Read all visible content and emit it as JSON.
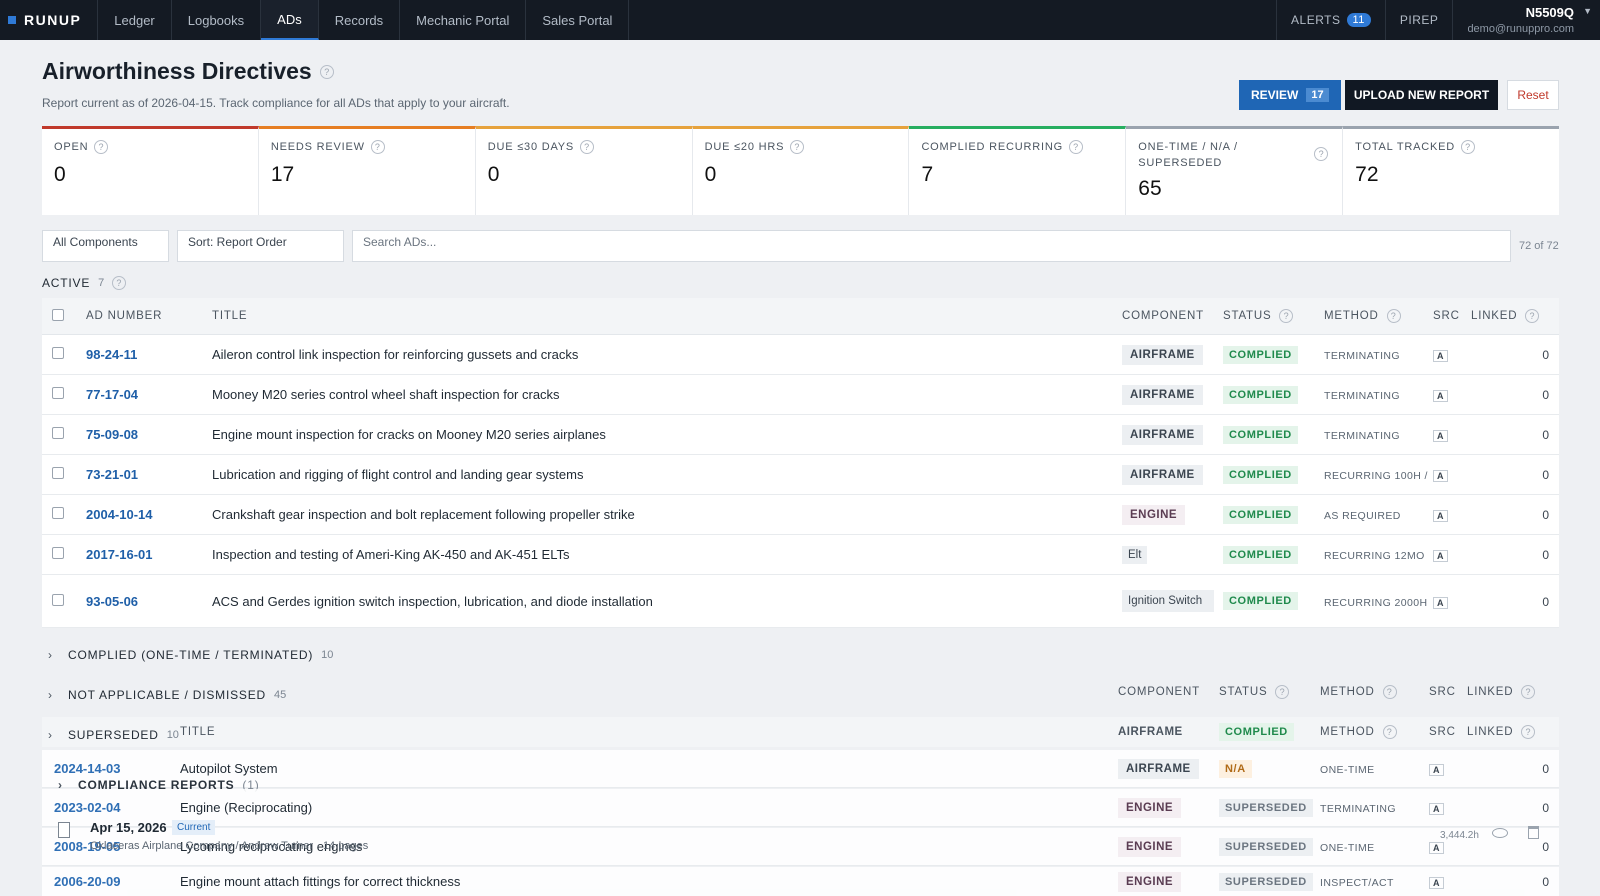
{
  "nav": {
    "brand": "RUNUP",
    "items": [
      "Ledger",
      "Logbooks",
      "ADs",
      "Records",
      "Mechanic Portal",
      "Sales Portal"
    ],
    "alerts_label": "ALERTS",
    "alerts_count": "11",
    "pirep": "PIREP",
    "tail": "N5509Q",
    "email": "demo@runuppro.com"
  },
  "header": {
    "title": "Airworthiness Directives",
    "help": "?",
    "subtitle": "Report current as of 2026-04-15. Track compliance for all ADs that apply to your aircraft.",
    "review_label": "REVIEW",
    "review_count": "17",
    "upload_label": "UPLOAD NEW REPORT",
    "reset_label": "Reset"
  },
  "stats": [
    {
      "label": "OPEN",
      "value": "0",
      "color": "#c0392b"
    },
    {
      "label": "NEEDS REVIEW",
      "value": "17",
      "color": "#e67e22"
    },
    {
      "label": "DUE ≤30 DAYS",
      "value": "0",
      "color": "#e6a23c"
    },
    {
      "label": "DUE ≤20 HRS",
      "value": "0",
      "color": "#e6a23c"
    },
    {
      "label": "COMPLIED RECURRING",
      "value": "7",
      "color": "#27ae60"
    },
    {
      "label": "ONE-TIME / N/A / SUPERSEDED",
      "value": "65",
      "color": "#9aa3ae"
    },
    {
      "label": "TOTAL TRACKED",
      "value": "72",
      "color": "#9aa3ae"
    }
  ],
  "filters": {
    "component": "All Components",
    "sort": "Sort: Report Order",
    "search_placeholder": "Search ADs...",
    "count": "72 of 72"
  },
  "active": {
    "label": "ACTIVE",
    "count": "7"
  },
  "columns": {
    "ad": "AD NUMBER",
    "title": "TITLE",
    "component": "COMPONENT",
    "status": "STATUS",
    "method": "METHOD",
    "src": "SRC",
    "linked": "LINKED"
  },
  "rows": [
    {
      "ad": "98-24-11",
      "title": "Aileron control link inspection for reinforcing gussets and cracks",
      "component": "AIRFRAME",
      "status": "COMPLIED",
      "method": "TERMINATING",
      "src": "A",
      "linked": "0"
    },
    {
      "ad": "77-17-04",
      "title": "Mooney M20 series control wheel shaft inspection for cracks",
      "component": "AIRFRAME",
      "status": "COMPLIED",
      "method": "TERMINATING",
      "src": "A",
      "linked": "0"
    },
    {
      "ad": "75-09-08",
      "title": "Engine mount inspection for cracks on Mooney M20 series airplanes",
      "component": "AIRFRAME",
      "status": "COMPLIED",
      "method": "TERMINATING",
      "src": "A",
      "linked": "0"
    },
    {
      "ad": "73-21-01",
      "title": "Lubrication and rigging of flight control and landing gear systems",
      "component": "AIRFRAME",
      "status": "COMPLIED",
      "method": "RECURRING 100H /",
      "src": "A",
      "linked": "0"
    },
    {
      "ad": "2004-10-14",
      "title": "Crankshaft gear inspection and bolt replacement following propeller strike",
      "component": "ENGINE",
      "status": "COMPLIED",
      "method": "AS REQUIRED",
      "src": "A",
      "linked": "0"
    },
    {
      "ad": "2017-16-01",
      "title": "Inspection and testing of Ameri-King AK-450 and AK-451 ELTs",
      "component": "Elt",
      "status": "COMPLIED",
      "method": "RECURRING 12MO",
      "src": "A",
      "linked": "0"
    },
    {
      "ad": "93-05-06",
      "title": "ACS and Gerdes ignition switch inspection, lubrication, and diode installation",
      "component": "Ignition Switch",
      "status": "COMPLIED",
      "method": "RECURRING 2000H",
      "src": "A",
      "linked": "0"
    }
  ],
  "collapsed": [
    {
      "label": "COMPLIED (ONE-TIME / TERMINATED)",
      "count": "10"
    },
    {
      "label": "NOT APPLICABLE / DISMISSED",
      "count": "45"
    },
    {
      "label": "SUPERSEDED",
      "count": "10"
    }
  ],
  "overlap_rows": [
    {
      "ad": "2024-14-03",
      "title": "Autopilot System",
      "component": "AIRFRAME",
      "status": "N/A",
      "method": "ONE-TIME",
      "src": "A",
      "linked": "0"
    },
    {
      "ad": "2023-02-04",
      "title": "Engine (Reciprocating)",
      "component": "ENGINE",
      "status": "SUPERSEDED",
      "method": "TERMINATING",
      "src": "A",
      "linked": "0"
    },
    {
      "ad": "2008-19-05",
      "title": "Lycoming reciprocating engines",
      "component": "ENGINE",
      "status": "SUPERSEDED",
      "method": "ONE-TIME",
      "src": "A",
      "linked": "0"
    },
    {
      "ad": "2006-20-09",
      "title": "Engine mount attach fittings for correct thickness",
      "component": "ENGINE",
      "status": "SUPERSEDED",
      "method": "INSPECT/ACT",
      "src": "A",
      "linked": "0"
    }
  ],
  "compliance_reports": {
    "label": "COMPLIANCE REPORTS",
    "count": "(1)",
    "date": "Apr 15, 2026",
    "badge": "Current",
    "meta": "Oklaceras Airplane Company / Andrew Turner · 14 pages",
    "hours": "3,444.2h"
  }
}
